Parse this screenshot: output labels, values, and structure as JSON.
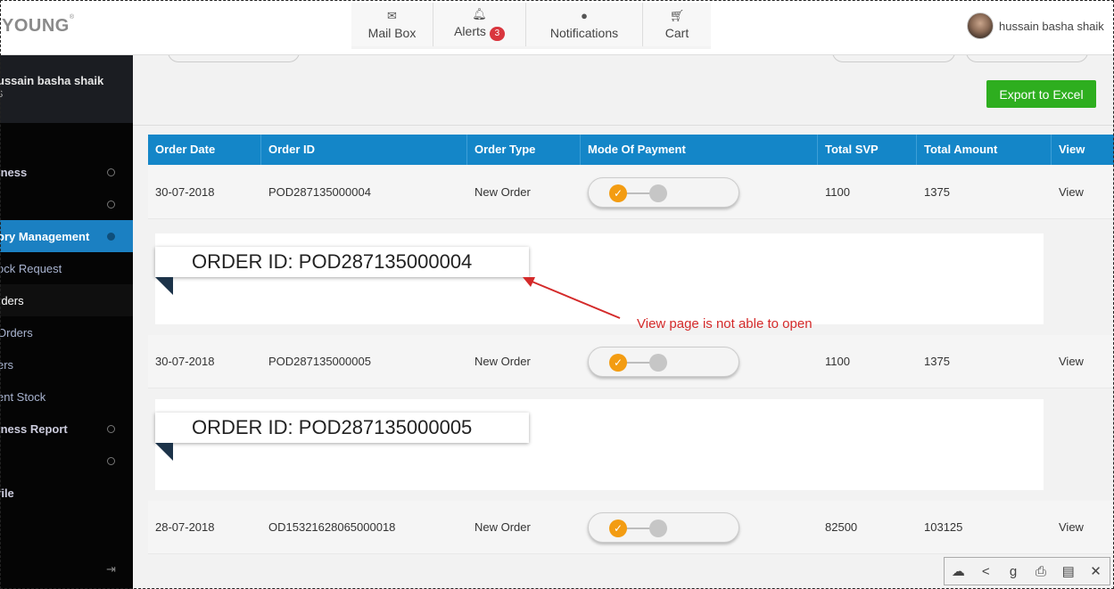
{
  "header": {
    "logo": "YOUNG",
    "logo_mark": "®",
    "nav": [
      {
        "label": "Mail Box",
        "icon": "mail-icon",
        "glyph": "✉"
      },
      {
        "label": "Alerts",
        "icon": "bell-icon",
        "glyph": "🔔︎",
        "badge": "3"
      },
      {
        "label": "Notifications",
        "icon": "globe-icon",
        "glyph": "●"
      },
      {
        "label": "Cart",
        "icon": "cart-icon",
        "glyph": "🛒︎"
      }
    ],
    "user_name": "hussain basha shaik"
  },
  "sidebar": {
    "profile_name": "ussain basha shaik",
    "profile_code": "S",
    "items": [
      {
        "label": "iness",
        "type": "head",
        "dot": true
      },
      {
        "label": "",
        "type": "head",
        "dot": true
      },
      {
        "label": "ory Management",
        "type": "active",
        "dot": true
      },
      {
        "label": "ock Request",
        "type": "sub",
        "dot": false
      },
      {
        "label": "rders",
        "type": "sel",
        "dot": false
      },
      {
        "label": "Orders",
        "type": "sub",
        "dot": false
      },
      {
        "label": "ers",
        "type": "sub",
        "dot": false
      },
      {
        "label": "ent Stock",
        "type": "sub",
        "dot": false
      },
      {
        "label": "iness Report",
        "type": "head",
        "dot": true
      },
      {
        "label": "",
        "type": "head",
        "dot": true
      },
      {
        "label": "file",
        "type": "head",
        "dot": false
      }
    ],
    "logout_icon": "logout-icon"
  },
  "main": {
    "export_label": "Export to Excel",
    "columns": [
      "Order Date",
      "Order ID",
      "Order Type",
      "Mode Of Payment",
      "Total SVP",
      "Total Amount",
      "View"
    ],
    "rows": [
      {
        "date": "30-07-2018",
        "id": "POD287135000004",
        "type": "New Order",
        "svp": "1100",
        "amount": "1375",
        "view": "View"
      },
      {
        "date": "30-07-2018",
        "id": "POD287135000005",
        "type": "New Order",
        "svp": "1100",
        "amount": "1375",
        "view": "View"
      },
      {
        "date": "28-07-2018",
        "id": "OD15321628065000018",
        "type": "New Order",
        "svp": "82500",
        "amount": "103125",
        "view": "View"
      }
    ],
    "details": [
      {
        "title": "ORDER ID: POD287135000004"
      },
      {
        "title": "ORDER ID: POD287135000005"
      }
    ],
    "annotation": "View page is not able to open",
    "annotation_color": "#d42a2a",
    "header_color": "#1486c8",
    "export_color": "#2eae1f",
    "toggle_color": "#f39c12"
  },
  "toolbar": {
    "buttons": [
      {
        "name": "cloud-upload-icon",
        "glyph": "☁"
      },
      {
        "name": "share-icon",
        "glyph": "<"
      },
      {
        "name": "google-icon",
        "glyph": "g"
      },
      {
        "name": "print-icon",
        "glyph": "⎙"
      },
      {
        "name": "save-icon",
        "glyph": "▤"
      },
      {
        "name": "close-icon",
        "glyph": "✕"
      }
    ]
  }
}
